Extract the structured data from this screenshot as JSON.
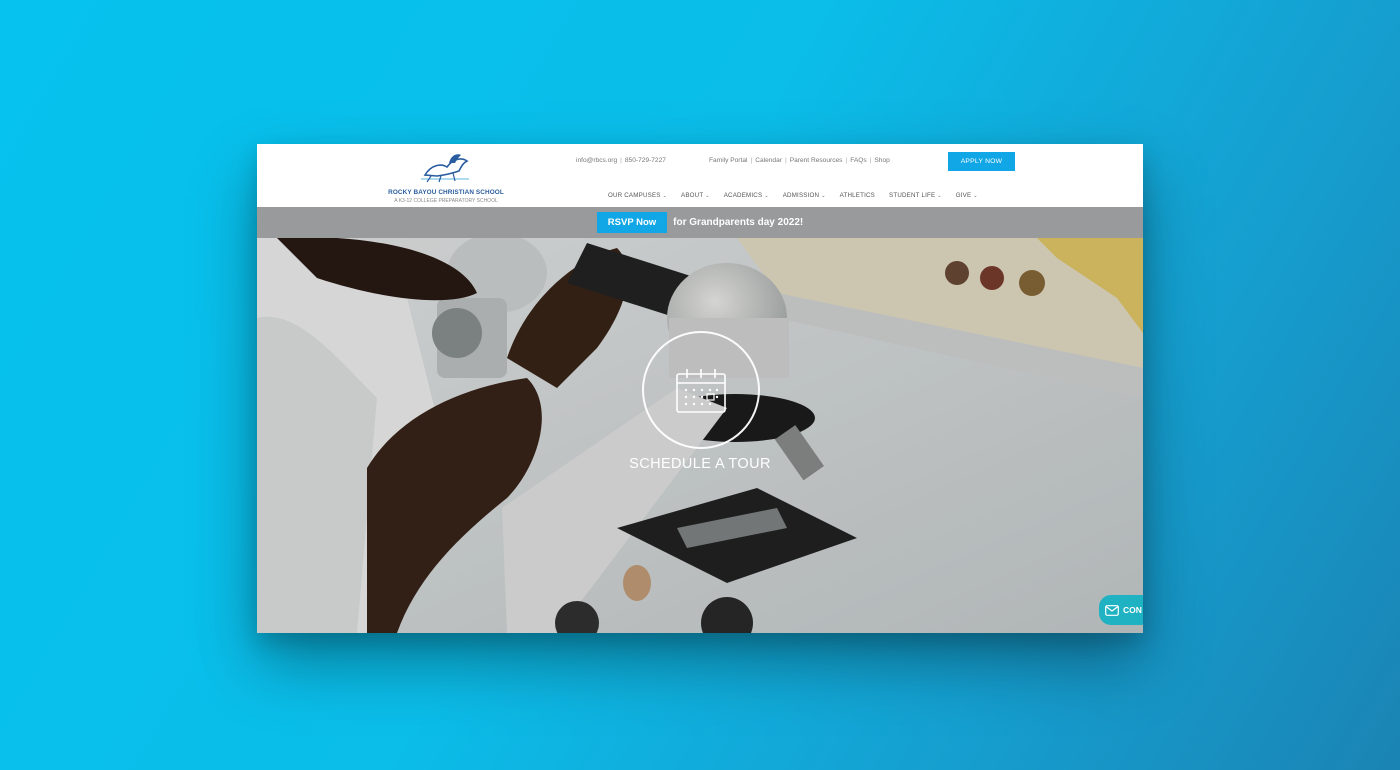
{
  "header": {
    "logo": {
      "name": "ROCKY BAYOU CHRISTIAN SCHOOL",
      "tagline": "A K3-12 COLLEGE PREPARATORY SCHOOL"
    },
    "utility": {
      "email": "info@rbcs.org",
      "phone": "850-729-7227",
      "links": [
        "Family Portal",
        "Calendar",
        "Parent Resources",
        "FAQs",
        "Shop"
      ]
    },
    "apply_label": "APPLY NOW",
    "nav": [
      {
        "label": "OUR CAMPUSES",
        "dropdown": true
      },
      {
        "label": "ABOUT",
        "dropdown": true
      },
      {
        "label": "ACADEMICS",
        "dropdown": true
      },
      {
        "label": "ADMISSION",
        "dropdown": true
      },
      {
        "label": "ATHLETICS",
        "dropdown": false
      },
      {
        "label": "STUDENT LIFE",
        "dropdown": true
      },
      {
        "label": "GIVE",
        "dropdown": true
      }
    ]
  },
  "banner": {
    "button_label": "RSVP Now",
    "text": "for Grandparents day 2022!"
  },
  "hero": {
    "cta_label": "SCHEDULE A TOUR",
    "cta_icon": "calendar-icon"
  },
  "contact_widget": {
    "label": "CON",
    "icon": "envelope-icon"
  },
  "colors": {
    "accent": "#11a7e6",
    "banner_bg": "#999a9b",
    "logo_blue": "#2a5d9f",
    "contact_teal": "#1fb2c2"
  }
}
